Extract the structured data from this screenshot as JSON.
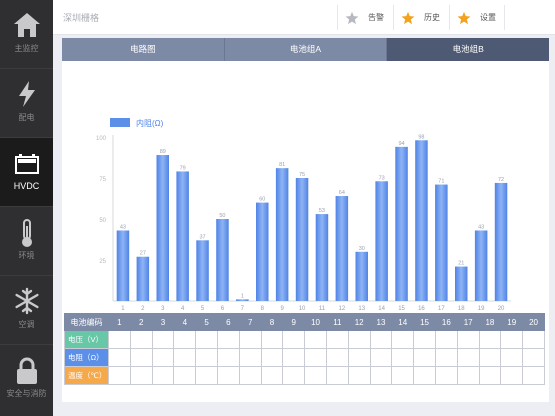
{
  "sidebar": {
    "items": [
      {
        "label": "主监控",
        "icon": "home-icon",
        "active": false
      },
      {
        "label": "配电",
        "icon": "lightning-icon",
        "active": false
      },
      {
        "label": "HVDC",
        "icon": "battery-icon",
        "active": true
      },
      {
        "label": "环境",
        "icon": "thermometer-icon",
        "active": false
      },
      {
        "label": "空调",
        "icon": "snowflake-icon",
        "active": false
      },
      {
        "label": "安全与消防",
        "icon": "lock-icon",
        "active": false
      }
    ]
  },
  "topbar": {
    "location": "深圳栅格",
    "buttons": [
      {
        "label": "告警",
        "icon": "star-icon",
        "color": "#b7b9c0"
      },
      {
        "label": "历史",
        "icon": "star-icon",
        "color": "#f3a21e"
      },
      {
        "label": "设置",
        "icon": "star-icon",
        "color": "#f3a21e"
      }
    ]
  },
  "tabs": [
    {
      "label": "电路图",
      "active": false
    },
    {
      "label": "电池组A",
      "active": false
    },
    {
      "label": "电池组B",
      "active": true
    }
  ],
  "chart_data": {
    "type": "bar",
    "categories": [
      "1",
      "2",
      "3",
      "4",
      "5",
      "6",
      "7",
      "8",
      "9",
      "10",
      "11",
      "12",
      "13",
      "14",
      "15",
      "16",
      "17",
      "18",
      "19",
      "20"
    ],
    "series": [
      {
        "name": "内阻(Ω)",
        "color": "#5b8fe8",
        "values": [
          43,
          27,
          89,
          79,
          37,
          50,
          1,
          60,
          81,
          75,
          53,
          64,
          30,
          73,
          94,
          98,
          71,
          21,
          43,
          72
        ]
      }
    ],
    "ylim": [
      0,
      100
    ],
    "yticks": [
      "100",
      "75",
      "50",
      "25"
    ],
    "legend_position": "top-left"
  },
  "table": {
    "header": "电池编码",
    "columns": [
      "1",
      "2",
      "3",
      "4",
      "5",
      "6",
      "7",
      "8",
      "9",
      "10",
      "11",
      "12",
      "13",
      "14",
      "15",
      "16",
      "17",
      "18",
      "19",
      "20"
    ],
    "rows": [
      {
        "label": "电压（V）",
        "color": "#67c7a6"
      },
      {
        "label": "电阻（Ω）",
        "color": "#5b8fe8"
      },
      {
        "label": "温度（℃）",
        "color": "#f6a94b"
      }
    ]
  }
}
